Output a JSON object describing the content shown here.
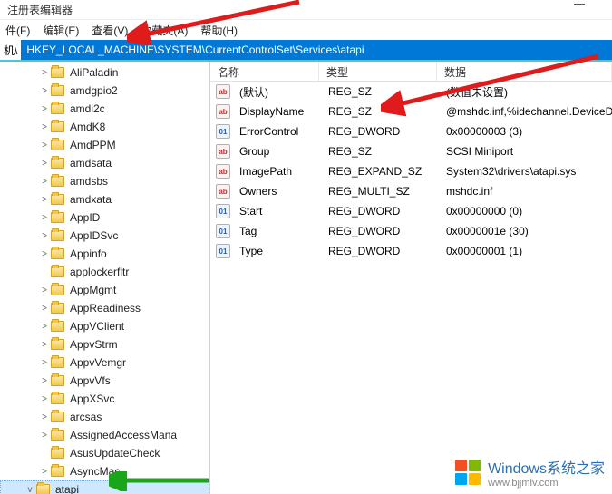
{
  "window": {
    "title": "注册表编辑器"
  },
  "menu": {
    "file": "件(F)",
    "edit": "编辑(E)",
    "view": "查看(V)",
    "favorites": "收藏夹(A)",
    "help": "帮助(H)"
  },
  "address": {
    "label": "机\\",
    "path": "HKEY_LOCAL_MACHINE\\SYSTEM\\CurrentControlSet\\Services\\atapi"
  },
  "tree": {
    "items": [
      {
        "name": "AliPaladin",
        "exp": ">"
      },
      {
        "name": "amdgpio2",
        "exp": ">"
      },
      {
        "name": "amdi2c",
        "exp": ">"
      },
      {
        "name": "AmdK8",
        "exp": ">"
      },
      {
        "name": "AmdPPM",
        "exp": ">"
      },
      {
        "name": "amdsata",
        "exp": ">"
      },
      {
        "name": "amdsbs",
        "exp": ">"
      },
      {
        "name": "amdxata",
        "exp": ">"
      },
      {
        "name": "AppID",
        "exp": ">"
      },
      {
        "name": "AppIDSvc",
        "exp": ">"
      },
      {
        "name": "Appinfo",
        "exp": ">"
      },
      {
        "name": "applockerfltr",
        "exp": ""
      },
      {
        "name": "AppMgmt",
        "exp": ">"
      },
      {
        "name": "AppReadiness",
        "exp": ">"
      },
      {
        "name": "AppVClient",
        "exp": ">"
      },
      {
        "name": "AppvStrm",
        "exp": ">"
      },
      {
        "name": "AppvVemgr",
        "exp": ">"
      },
      {
        "name": "AppvVfs",
        "exp": ">"
      },
      {
        "name": "AppXSvc",
        "exp": ">"
      },
      {
        "name": "arcsas",
        "exp": ">"
      },
      {
        "name": "AssignedAccessMana",
        "exp": ">"
      },
      {
        "name": "AsusUpdateCheck",
        "exp": ""
      },
      {
        "name": "AsyncMac",
        "exp": ">"
      }
    ],
    "selected": {
      "name": "atapi",
      "exp": "v"
    }
  },
  "columns": {
    "name": "名称",
    "type": "类型",
    "data": "数据"
  },
  "values": [
    {
      "icon": "str",
      "name": "(默认)",
      "type": "REG_SZ",
      "data": "(数值未设置)"
    },
    {
      "icon": "str",
      "name": "DisplayName",
      "type": "REG_SZ",
      "data": "@mshdc.inf,%idechannel.DeviceD"
    },
    {
      "icon": "bin",
      "name": "ErrorControl",
      "type": "REG_DWORD",
      "data": "0x00000003 (3)"
    },
    {
      "icon": "str",
      "name": "Group",
      "type": "REG_SZ",
      "data": "SCSI Miniport"
    },
    {
      "icon": "str",
      "name": "ImagePath",
      "type": "REG_EXPAND_SZ",
      "data": "System32\\drivers\\atapi.sys"
    },
    {
      "icon": "str",
      "name": "Owners",
      "type": "REG_MULTI_SZ",
      "data": "mshdc.inf"
    },
    {
      "icon": "bin",
      "name": "Start",
      "type": "REG_DWORD",
      "data": "0x00000000 (0)"
    },
    {
      "icon": "bin",
      "name": "Tag",
      "type": "REG_DWORD",
      "data": "0x0000001e (30)"
    },
    {
      "icon": "bin",
      "name": "Type",
      "type": "REG_DWORD",
      "data": "0x00000001 (1)"
    }
  ],
  "watermark": {
    "title": "Windows系统之家",
    "url": "www.bjjmlv.com"
  }
}
